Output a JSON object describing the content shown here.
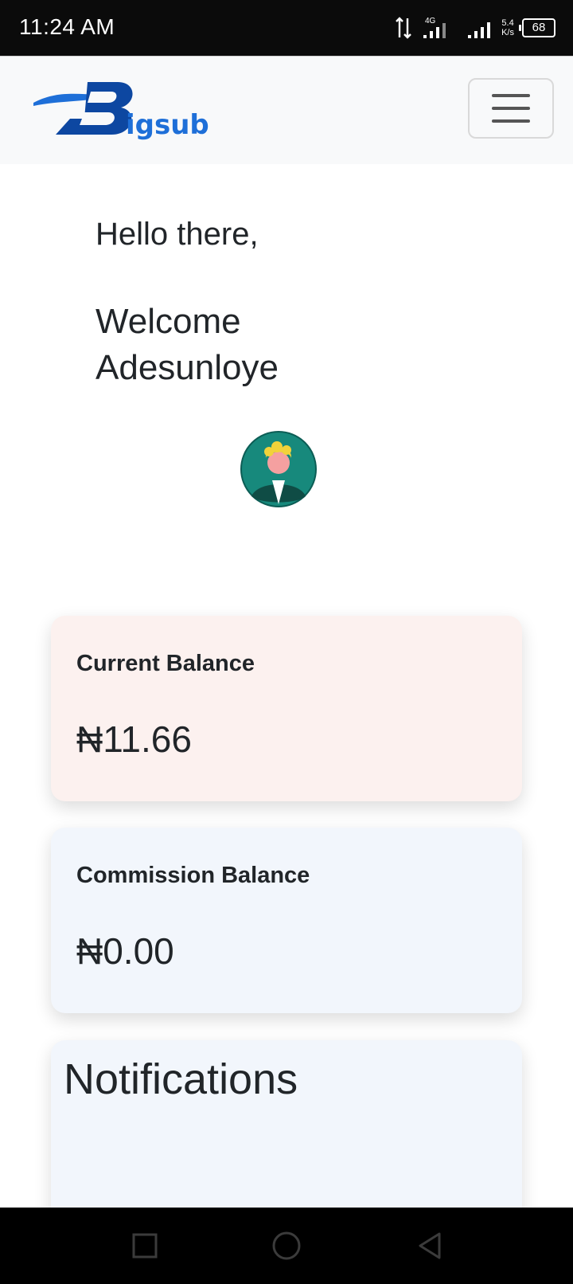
{
  "status_bar": {
    "time": "11:24 AM",
    "network": "4G",
    "speed_value": "5.4",
    "speed_unit": "K/s",
    "battery": "68"
  },
  "header": {
    "logo_text": "igsub",
    "logo_letter": "B",
    "menu_icon": "hamburger-icon"
  },
  "greeting": {
    "hello": "Hello there,",
    "welcome_line1": "Welcome",
    "welcome_line2": "Adesunloye"
  },
  "balances": [
    {
      "label": "Current Balance",
      "amount": "₦11.66"
    },
    {
      "label": "Commission Balance",
      "amount": "₦0.00"
    }
  ],
  "notifications": {
    "title": "Notifications"
  },
  "colors": {
    "brand_blue": "#1e6fd8",
    "current_card": "#fcf1ef",
    "commission_card": "#f2f6fc",
    "navbar_bg": "#f8f9fa"
  },
  "nav_bottom": {
    "recent_icon": "square-icon",
    "home_icon": "circle-icon",
    "back_icon": "triangle-back-icon"
  }
}
